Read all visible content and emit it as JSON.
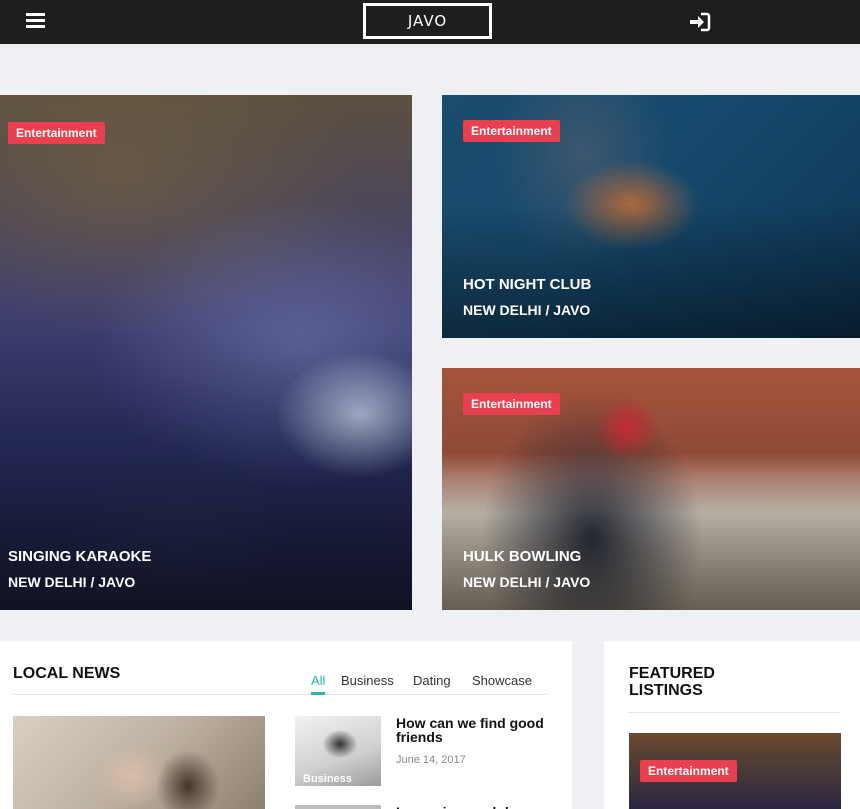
{
  "header": {
    "logo": "JAVO",
    "menu_icon": "hamburger-menu-icon",
    "login_icon": "sign-in-icon"
  },
  "hero_cards": [
    {
      "badge": "Entertainment",
      "title": "SINGING KARAOKE",
      "location": "NEW DELHI / JAVO"
    },
    {
      "badge": "Entertainment",
      "title": "HOT NIGHT CLUB",
      "location": "NEW DELHI / JAVO"
    },
    {
      "badge": "Entertainment",
      "title": "HULK BOWLING",
      "location": "NEW DELHI / JAVO"
    }
  ],
  "local_news": {
    "title": "LOCAL NEWS",
    "tabs": [
      "All",
      "Business",
      "Dating",
      "Showcase"
    ],
    "active_tab": "All",
    "items": [
      {
        "category": "Business",
        "title": "How can we find good friends",
        "date": "June 14, 2017"
      },
      {
        "title": "Lorem ipsum dolor"
      }
    ]
  },
  "featured": {
    "title": "FEATURED LISTINGS",
    "items": [
      {
        "badge": "Entertainment"
      }
    ]
  },
  "colors": {
    "topbar": "#1e1e1e",
    "badge": "#e8404e",
    "accent": "#2bb5a8",
    "background": "#eef0f3"
  }
}
